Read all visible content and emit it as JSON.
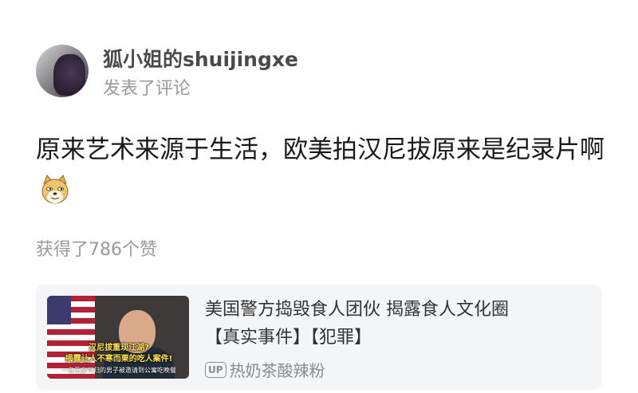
{
  "post": {
    "username": "狐小姐的shuijingxe",
    "action": "发表了评论",
    "comment_text": "原来艺术来源于生活，欧美拍汉尼拔原来是纪录片啊",
    "emoji_icon": "doge-emoji",
    "likes": "获得了786个赞"
  },
  "video_card": {
    "title_line1": "美国警方捣毁食人团伙 揭露食人文化圈",
    "title_line2": "【真实事件】【犯罪】",
    "up_label": "UP",
    "author": "热奶茶酸辣粉",
    "thumbnail": {
      "caption_line1": "汉尼拔重现江湖?",
      "caption_line2": "揭露让人不寒而栗的吃人案件!",
      "caption_line3": "一名无家可归的男子被邀请到公寓吃晚餐"
    }
  },
  "colors": {
    "username": "#4a4a4a",
    "secondary_text": "#9a9a9a",
    "card_background": "#f4f5f7"
  }
}
